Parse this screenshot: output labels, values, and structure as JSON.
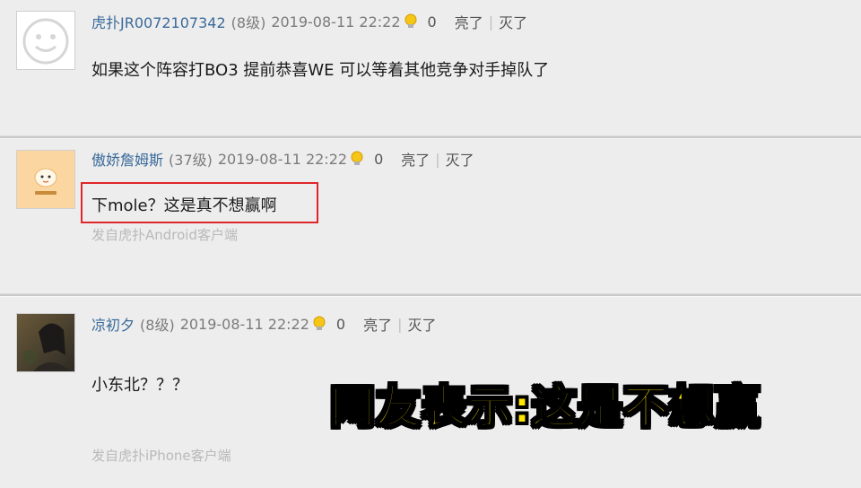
{
  "comments": [
    {
      "username": "虎扑JR0072107342",
      "level": "(8级)",
      "timestamp": "2019-08-11 22:22",
      "light_count": "0",
      "like_label": "亮了",
      "dislike_label": "灭了",
      "content": "如果这个阵容打BO3 提前恭喜WE 可以等着其他竞争对手掉队了",
      "avatar": "default-face-icon"
    },
    {
      "username": "傲娇詹姆斯",
      "level": "(37级)",
      "timestamp": "2019-08-11 22:22",
      "light_count": "0",
      "like_label": "亮了",
      "dislike_label": "灭了",
      "content": "下mole？这是真不想赢啊",
      "source": "发自虎扑Android客户端",
      "avatar": "cartoon-avatar",
      "highlight_color": "#e0262a"
    },
    {
      "username": "凉初夕",
      "level": "(8级)",
      "timestamp": "2019-08-11 22:22",
      "light_count": "0",
      "like_label": "亮了",
      "dislike_label": "灭了",
      "content": "小东北？？？",
      "source": "发自虎扑iPhone客户端",
      "avatar": "photo-avatar"
    }
  ],
  "caption": "网友表示:这是不想赢",
  "colors": {
    "caption_fill": "#ffe600",
    "caption_stroke": "#000000",
    "username": "#3a6a9a"
  }
}
